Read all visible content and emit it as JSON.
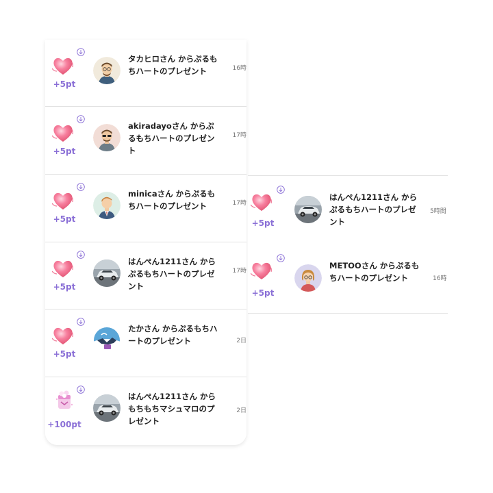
{
  "left_list": [
    {
      "points": "+5pt",
      "message": "タカヒロさん からぷるもちハートのプレゼント",
      "time": "16時",
      "gift_icon": "heart-icon",
      "avatar": "avatar-glasses-man"
    },
    {
      "points": "+5pt",
      "message": "akiradayoさん からぷるもちハートのプレゼント",
      "time": "17時",
      "gift_icon": "heart-icon",
      "avatar": "avatar-sunglasses-man"
    },
    {
      "points": "+5pt",
      "message": "minicaさん からぷるもちハートのプレゼント",
      "time": "17時",
      "gift_icon": "heart-icon",
      "avatar": "avatar-suit-man"
    },
    {
      "points": "+5pt",
      "message": "はんぺん1211さん からぷるもちハートのプレゼント",
      "time": "17時",
      "gift_icon": "heart-icon",
      "avatar": "avatar-car-photo"
    },
    {
      "points": "+5pt",
      "message": "たかさん からぷるもちハートのプレゼント",
      "time": "2日",
      "gift_icon": "heart-icon",
      "avatar": "avatar-illustration"
    },
    {
      "points": "+100pt",
      "message": "はんぺん1211さん からもちもちマシュマロのプレゼント",
      "time": "2日",
      "gift_icon": "marshmallow-icon",
      "avatar": "avatar-car-photo"
    }
  ],
  "right_list": [
    {
      "points": "+5pt",
      "message": "はんぺん1211さん からぷるもちハートのプレゼント",
      "time": "5時間",
      "gift_icon": "heart-icon",
      "avatar": "avatar-car-photo"
    },
    {
      "points": "+5pt",
      "message": "METOOさん からぷるもちハートのプレゼント",
      "time": "16時",
      "gift_icon": "heart-icon",
      "avatar": "avatar-girl-glasses"
    }
  ],
  "colors": {
    "points": "#8a6fd6",
    "heart": "#f07a98",
    "divider": "#e2e2e2"
  }
}
